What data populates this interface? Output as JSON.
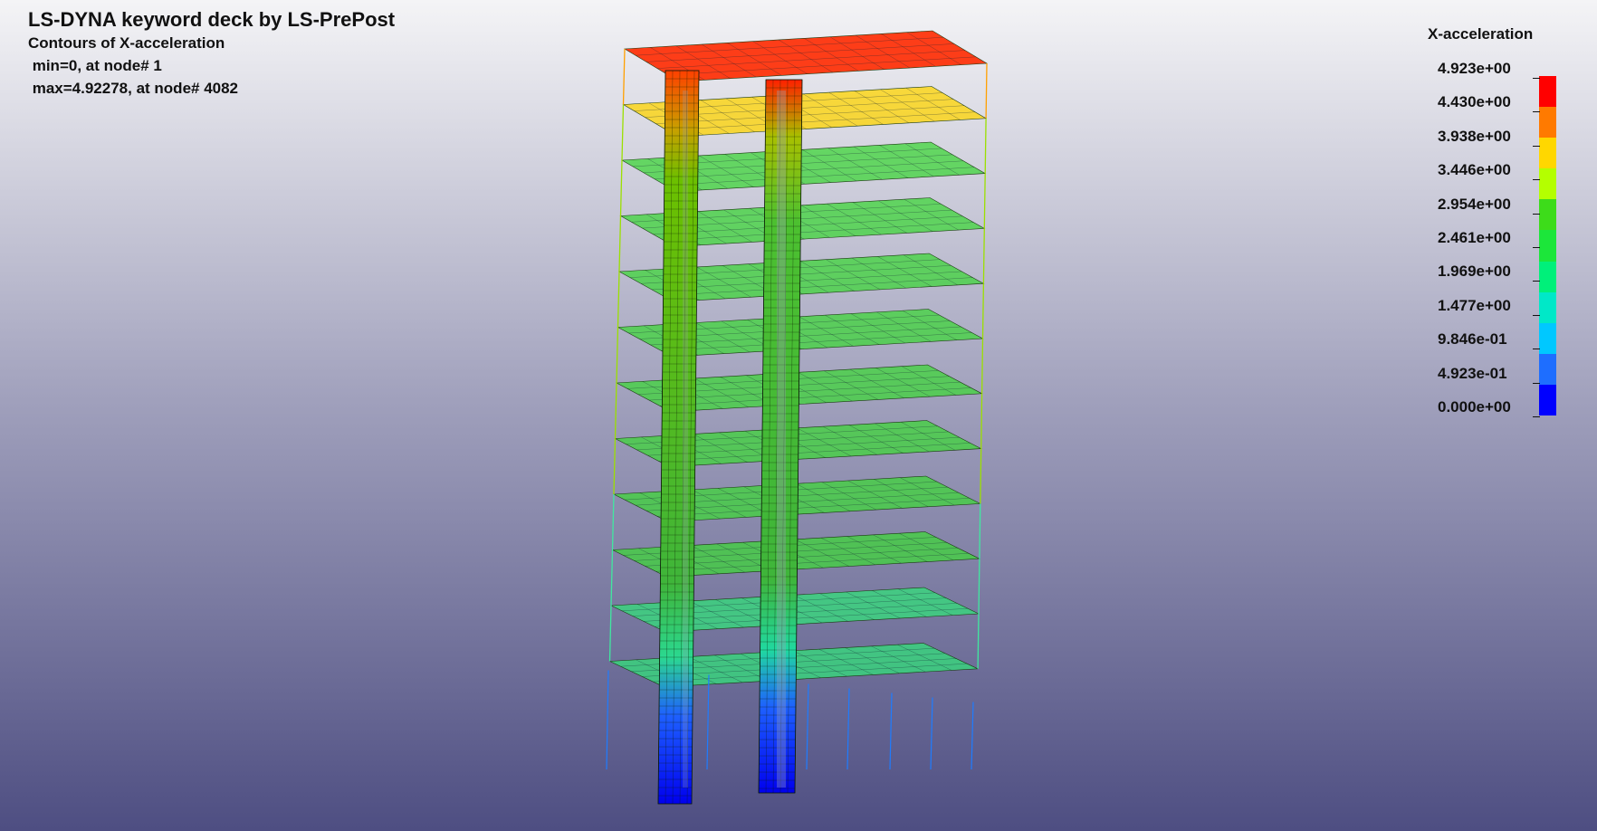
{
  "header": {
    "title": "LS-DYNA keyword deck by LS-PrePost",
    "subtitle": "Contours of X-acceleration",
    "min_text": " min=0, at node# 1",
    "max_text": " max=4.92278, at node# 4082"
  },
  "legend": {
    "title": "X-acceleration",
    "labels": [
      "4.923e+00",
      "4.430e+00",
      "3.938e+00",
      "3.446e+00",
      "2.954e+00",
      "2.461e+00",
      "1.969e+00",
      "1.477e+00",
      "9.846e-01",
      "4.923e-01",
      "0.000e+00"
    ],
    "colors": [
      "#ff0000",
      "#ff7a00",
      "#ffd700",
      "#b4ff00",
      "#3ddc1a",
      "#1ce63a",
      "#00f07a",
      "#00e8c8",
      "#00c8ff",
      "#1e6eff",
      "#0000ff"
    ]
  }
}
